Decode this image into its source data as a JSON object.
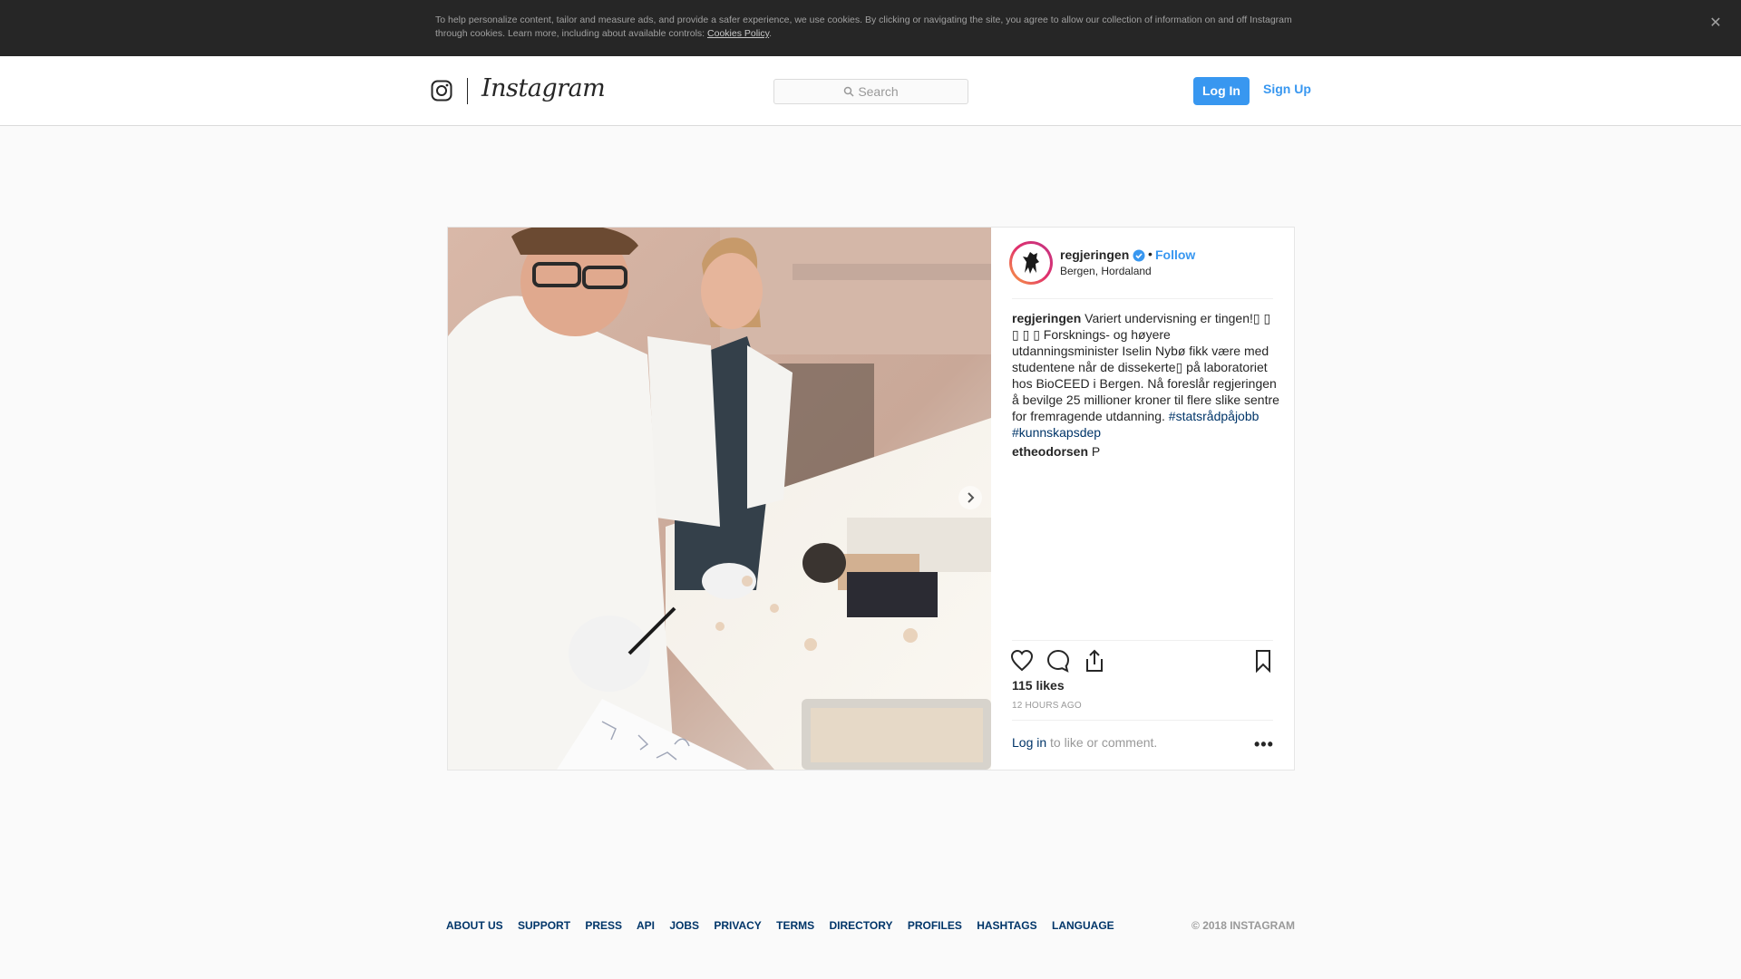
{
  "cookie_banner": {
    "text": "To help personalize content, tailor and measure ads, and provide a safer experience, we use cookies. By clicking or navigating the site, you agree to allow our collection of information on and off Instagram through cookies. Learn more, including about available controls: ",
    "link_label": "Cookies Policy",
    "trailing": ".",
    "close_glyph": "✕"
  },
  "header": {
    "wordmark": "Instagram",
    "search_placeholder": "Search",
    "login_label": "Log In",
    "signup_label": "Sign Up"
  },
  "post": {
    "username": "regjeringen",
    "dot": "•",
    "follow_label": "Follow",
    "location": "Bergen, Hordaland",
    "caption_user": "regjeringen",
    "caption_text": " Variert undervisning er tingen!▯ ▯ ▯ ▯ ▯ Forsknings- og høyere utdanningsminister Iselin Nybø fikk være med studentene når de dissekerte▯ på laboratoriet hos BioCEED i Bergen. Nå foreslår regjeringen å bevilge 25 millioner kroner til flere slike sentre for fremragende utdanning. ",
    "hashtag_1": "#statsrådpåjobb",
    "hashtag_2": "#kunnskapsdep",
    "comment_user": "etheodorsen",
    "comment_text": " P",
    "likes": "115 likes",
    "time": "12 HOURS AGO",
    "login_link": "Log in",
    "login_suffix": " to like or comment.",
    "more_glyph": "•••"
  },
  "icons": {
    "instagram": "instagram-glyph-icon",
    "search": "search-icon",
    "verified": "verified-badge-icon",
    "like": "heart-icon",
    "comment": "comment-icon",
    "share": "share-icon",
    "save": "bookmark-icon",
    "next": "chevron-right-icon"
  },
  "footer": {
    "links": [
      "ABOUT US",
      "SUPPORT",
      "PRESS",
      "API",
      "JOBS",
      "PRIVACY",
      "TERMS",
      "DIRECTORY",
      "PROFILES",
      "HASHTAGS",
      "LANGUAGE"
    ],
    "copyright": "© 2018 INSTAGRAM"
  },
  "colors": {
    "accent": "#3897f0",
    "link": "#003569",
    "banner": "#262626"
  }
}
